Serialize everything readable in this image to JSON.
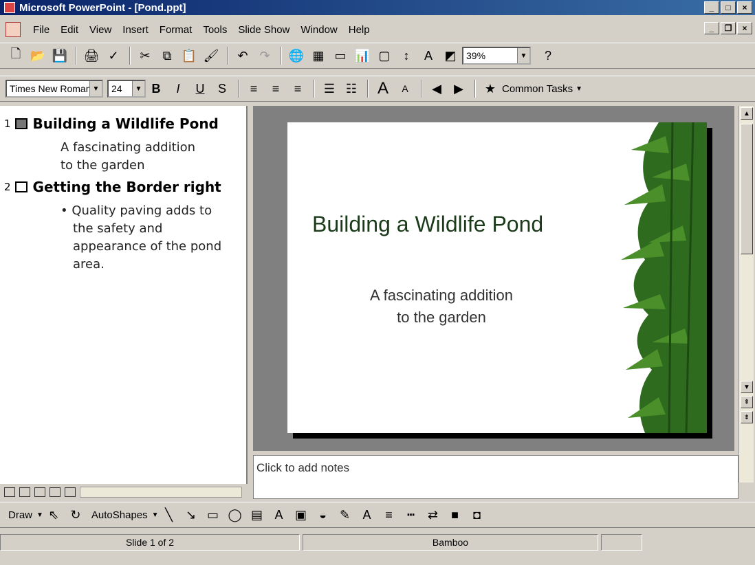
{
  "window": {
    "title": "Microsoft PowerPoint - [Pond.ppt]"
  },
  "menu": [
    "File",
    "Edit",
    "View",
    "Insert",
    "Format",
    "Tools",
    "Slide Show",
    "Window",
    "Help"
  ],
  "standard_toolbar": {
    "zoom": "39%"
  },
  "formatting_toolbar": {
    "font": "Times New Roman",
    "size": "24",
    "bold": "B",
    "italic": "I",
    "underline": "U",
    "shadow": "S",
    "common_tasks": "Common Tasks"
  },
  "outline": {
    "slides": [
      {
        "number": "1",
        "title": "Building a Wildlife Pond",
        "lines": [
          "A fascinating addition",
          "to the garden"
        ]
      },
      {
        "number": "2",
        "title": "Getting the Border right",
        "lines": [
          "• Quality paving adds to",
          "the safety and",
          "appearance of the pond",
          "area."
        ]
      }
    ]
  },
  "slide": {
    "title": "Building a Wildlife Pond",
    "subtitle_line1": "A fascinating addition",
    "subtitle_line2": "to the garden"
  },
  "notes": {
    "placeholder": "Click to add notes"
  },
  "drawing_toolbar": {
    "draw": "Draw",
    "autoshapes": "AutoShapes"
  },
  "status": {
    "slide": "Slide 1 of 2",
    "design": "Bamboo"
  }
}
